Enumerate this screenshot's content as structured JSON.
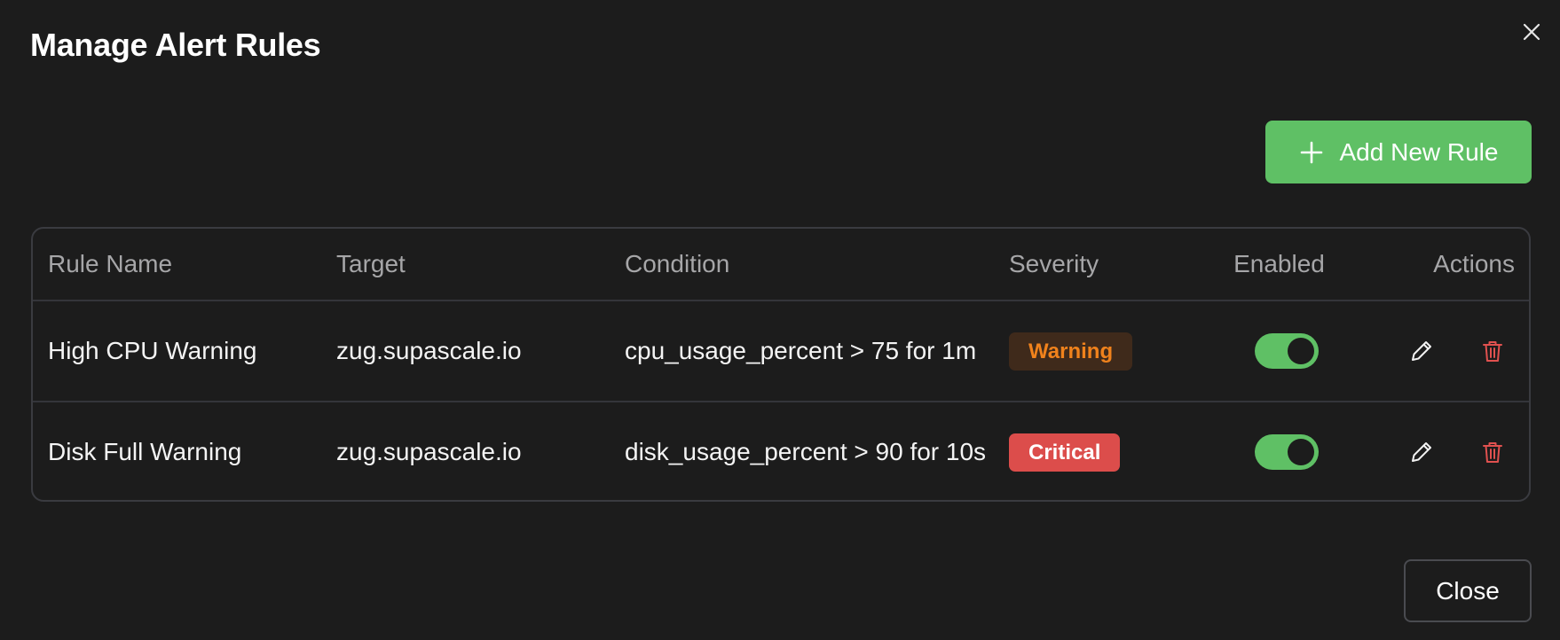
{
  "dialog": {
    "title": "Manage Alert Rules",
    "close_icon": "close-icon",
    "add_button_label": "Add New Rule",
    "add_icon": "plus-icon",
    "close_button_label": "Close"
  },
  "table": {
    "headers": [
      "Rule Name",
      "Target",
      "Condition",
      "Severity",
      "Enabled",
      "Actions"
    ],
    "rows": [
      {
        "name": "High CPU Warning",
        "target": "zug.supascale.io",
        "condition": "cpu_usage_percent > 75 for 1m",
        "severity": "Warning",
        "enabled": true,
        "edit_icon": "pencil-icon",
        "delete_icon": "trash-icon"
      },
      {
        "name": "Disk Full Warning",
        "target": "zug.supascale.io",
        "condition": "disk_usage_percent > 90 for 10s",
        "severity": "Critical",
        "enabled": true,
        "edit_icon": "pencil-icon",
        "delete_icon": "trash-icon"
      }
    ]
  },
  "colors": {
    "background": "#1c1c1c",
    "accent_green": "#5fc065",
    "warning_text": "#f0821c",
    "warning_bg": "#3f2a1b",
    "critical_bg": "#dc4d4b",
    "delete_red": "#e0514f",
    "border": "#3a3b40",
    "header_text": "#a6a6a8"
  }
}
